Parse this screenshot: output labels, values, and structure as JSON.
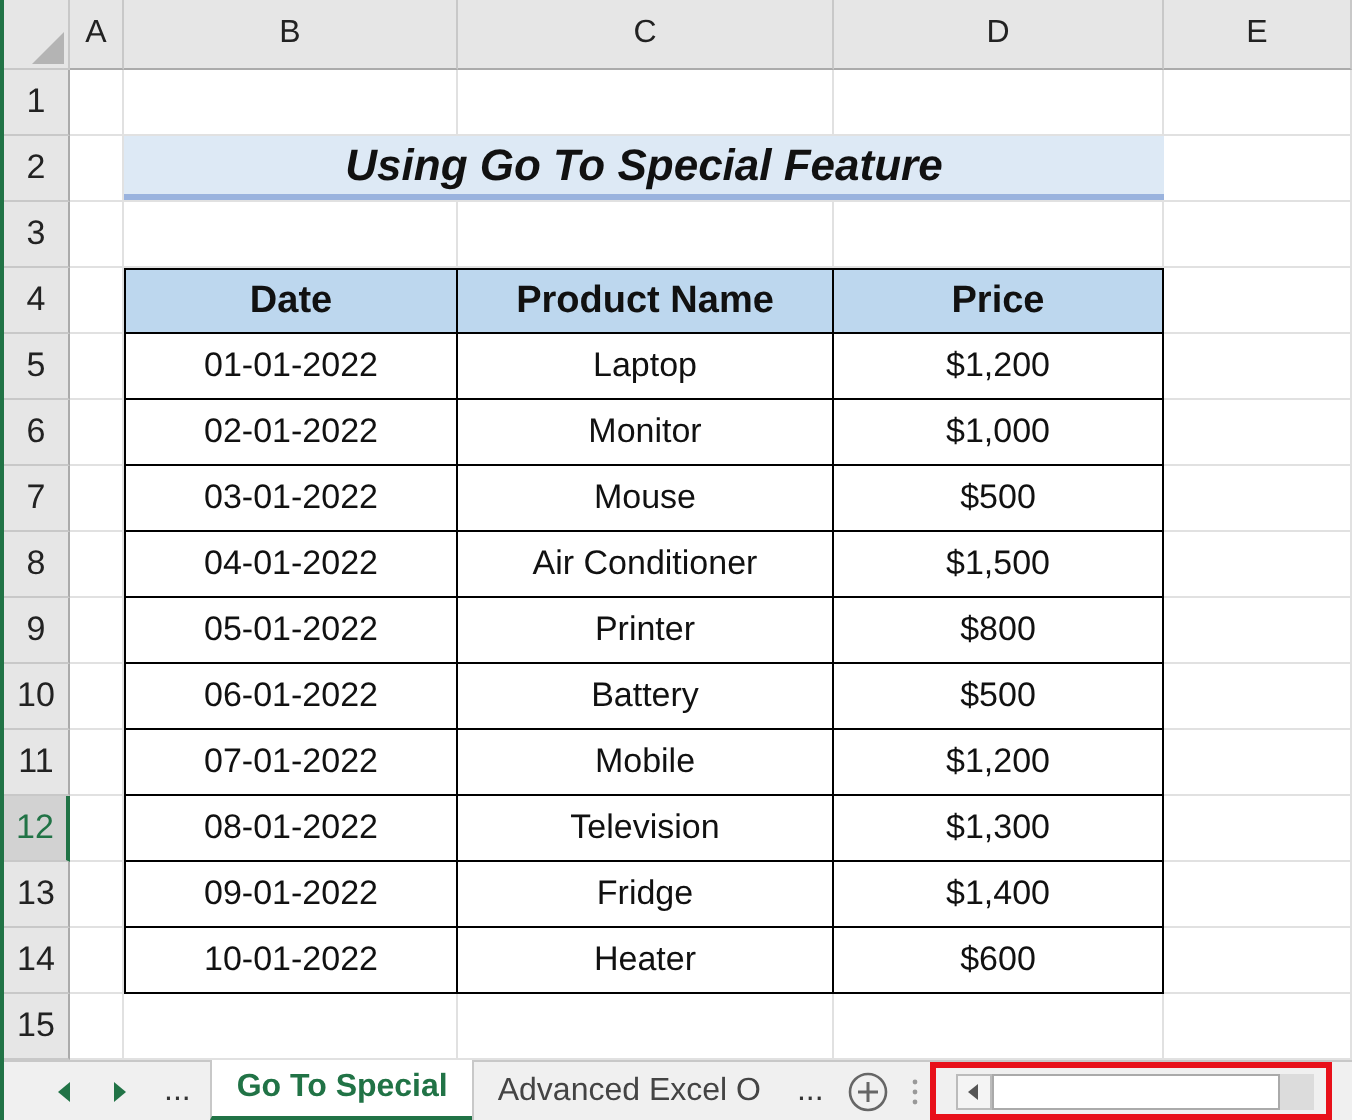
{
  "columns": [
    {
      "label": "A",
      "selected": false
    },
    {
      "label": "B",
      "selected": false
    },
    {
      "label": "C",
      "selected": false
    },
    {
      "label": "D",
      "selected": false
    },
    {
      "label": "E",
      "selected": false
    }
  ],
  "rows": [
    {
      "number": "1",
      "selected": false
    },
    {
      "number": "2",
      "selected": false
    },
    {
      "number": "3",
      "selected": false
    },
    {
      "number": "4",
      "selected": false
    },
    {
      "number": "5",
      "selected": false
    },
    {
      "number": "6",
      "selected": false
    },
    {
      "number": "7",
      "selected": false
    },
    {
      "number": "8",
      "selected": false
    },
    {
      "number": "9",
      "selected": false
    },
    {
      "number": "10",
      "selected": false
    },
    {
      "number": "11",
      "selected": false
    },
    {
      "number": "12",
      "selected": true
    },
    {
      "number": "13",
      "selected": false
    },
    {
      "number": "14",
      "selected": false
    },
    {
      "number": "15",
      "selected": false
    }
  ],
  "title": "Using Go To Special Feature",
  "table": {
    "columns": [
      "Date",
      "Product Name",
      "Price"
    ],
    "rows": [
      [
        "01-01-2022",
        "Laptop",
        "$1,200"
      ],
      [
        "02-01-2022",
        "Monitor",
        "$1,000"
      ],
      [
        "03-01-2022",
        "Mouse",
        "$500"
      ],
      [
        "04-01-2022",
        "Air Conditioner",
        "$1,500"
      ],
      [
        "05-01-2022",
        "Printer",
        "$800"
      ],
      [
        "06-01-2022",
        "Battery",
        "$500"
      ],
      [
        "07-01-2022",
        "Mobile",
        "$1,200"
      ],
      [
        "08-01-2022",
        "Television",
        "$1,300"
      ],
      [
        "09-01-2022",
        "Fridge",
        "$1,400"
      ],
      [
        "10-01-2022",
        "Heater",
        "$600"
      ]
    ]
  },
  "sheet_bar": {
    "more_left": "...",
    "tabs": [
      {
        "label": "Go To Special",
        "selected": true
      },
      {
        "label": "Advanced Excel O",
        "selected": false
      }
    ],
    "more_right": "..."
  }
}
